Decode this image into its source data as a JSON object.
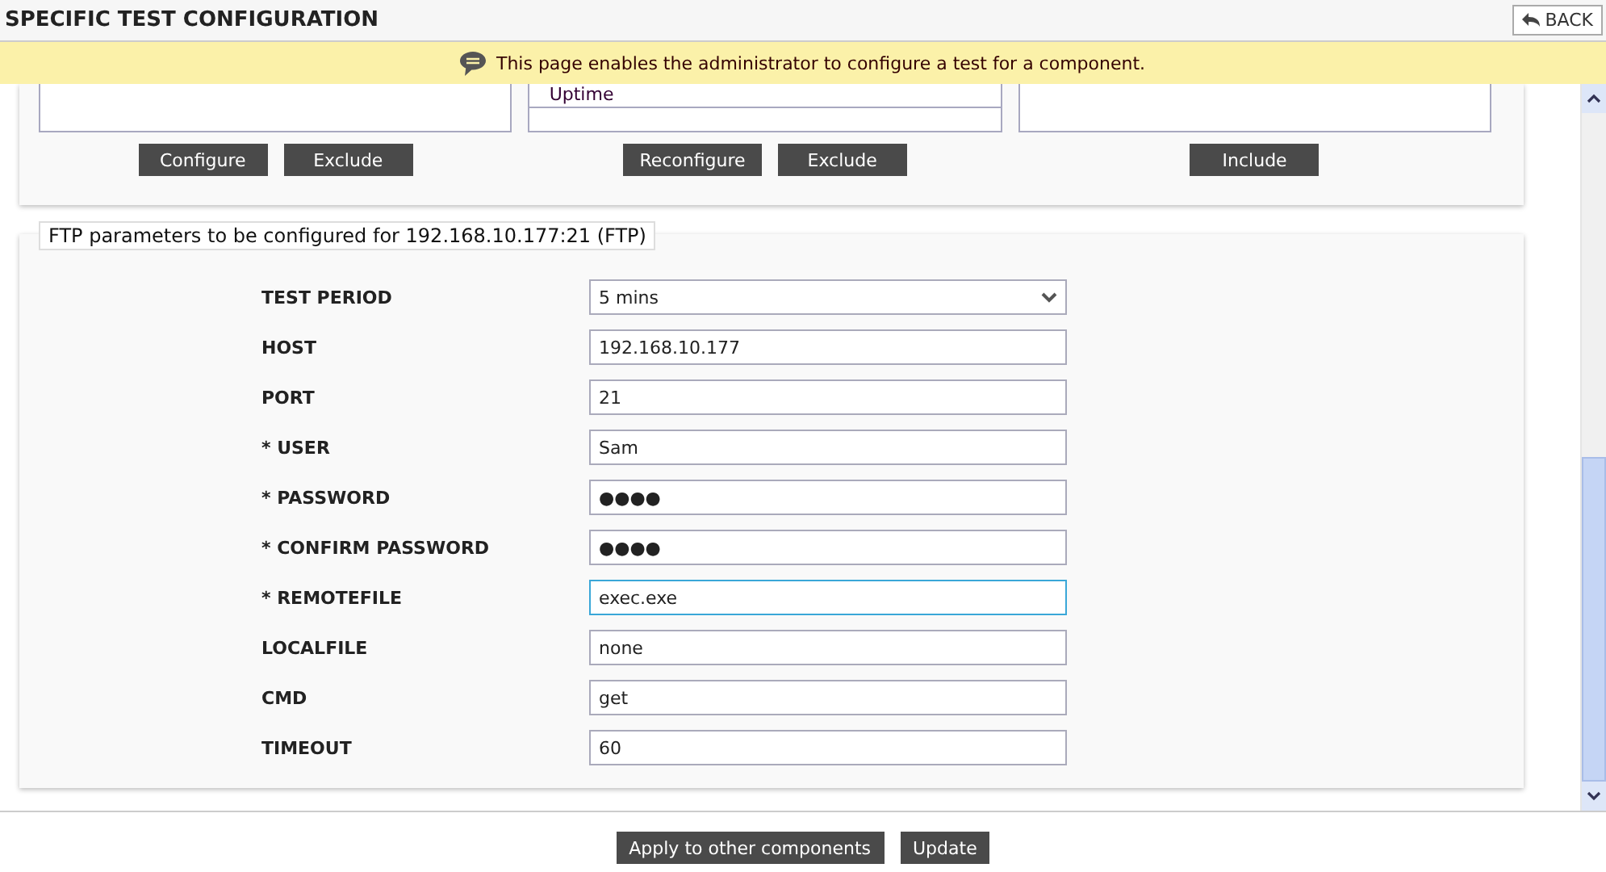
{
  "header": {
    "title": "SPECIFIC TEST CONFIGURATION",
    "back_button": "BACK"
  },
  "banner": {
    "message": "This page enables the administrator to configure a test for a component."
  },
  "test_lists": [
    {
      "buttons": [
        "Configure",
        "Exclude"
      ]
    },
    {
      "items": [
        "Uptime"
      ],
      "buttons": [
        "Reconfigure",
        "Exclude"
      ]
    },
    {
      "buttons": [
        "Include"
      ]
    }
  ],
  "parameters": {
    "legend": "FTP parameters to be configured for 192.168.10.177:21 (FTP)",
    "fields": [
      {
        "label": "TEST PERIOD",
        "kind": "select",
        "value": "5 mins",
        "focused": false
      },
      {
        "label": "HOST",
        "kind": "text",
        "value": "192.168.10.177",
        "focused": false
      },
      {
        "label": "PORT",
        "kind": "text",
        "value": "21",
        "focused": false
      },
      {
        "label": "* USER",
        "kind": "text",
        "value": "Sam",
        "focused": false
      },
      {
        "label": "* PASSWORD",
        "kind": "password",
        "value": "●●●●",
        "focused": false
      },
      {
        "label": "* CONFIRM PASSWORD",
        "kind": "password",
        "value": "●●●●",
        "focused": false
      },
      {
        "label": "* REMOTEFILE",
        "kind": "text",
        "value": "exec.exe",
        "focused": true
      },
      {
        "label": "LOCALFILE",
        "kind": "text",
        "value": "none",
        "focused": false
      },
      {
        "label": "CMD",
        "kind": "text",
        "value": "get",
        "focused": false
      },
      {
        "label": "TIMEOUT",
        "kind": "text",
        "value": "60",
        "focused": false
      }
    ]
  },
  "footer_buttons": [
    "Apply to other components",
    "Update"
  ]
}
